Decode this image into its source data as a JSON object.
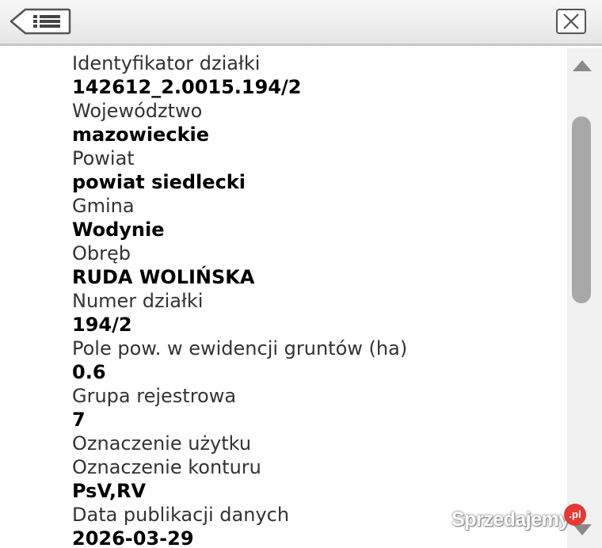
{
  "toolbar": {
    "back_icon": "list-back-icon",
    "close_icon": "close-icon"
  },
  "attributes": [
    {
      "label": "Identyfikator działki",
      "value": "142612_2.0015.194/2"
    },
    {
      "label": "Województwo",
      "value": "mazowieckie"
    },
    {
      "label": "Powiat",
      "value": "powiat siedlecki"
    },
    {
      "label": "Gmina",
      "value": "Wodynie"
    },
    {
      "label": "Obręb",
      "value": "RUDA WOLIŃSKA"
    },
    {
      "label": "Numer działki",
      "value": "194/2"
    },
    {
      "label": "Pole pow. w ewidencji gruntów (ha)",
      "value": "0.6"
    },
    {
      "label": "Grupa rejestrowa",
      "value": "7"
    },
    {
      "label": "Oznaczenie użytku",
      "value": ""
    },
    {
      "label": "Oznaczenie konturu",
      "value": "PsV,RV"
    },
    {
      "label": "Data publikacji danych",
      "value": "2026-03-29"
    }
  ],
  "scrollbar": {
    "up_icon": "scroll-up-arrow-icon",
    "down_icon": "scroll-down-arrow-icon"
  },
  "watermark": {
    "text": "Sprzedajemy",
    "badge": ".pl"
  },
  "colors": {
    "toolbar_bg": "#ececec",
    "label_text": "#333333",
    "value_text": "#000000",
    "scroll_thumb": "#a8a8a8",
    "watermark_badge": "#e53935"
  }
}
